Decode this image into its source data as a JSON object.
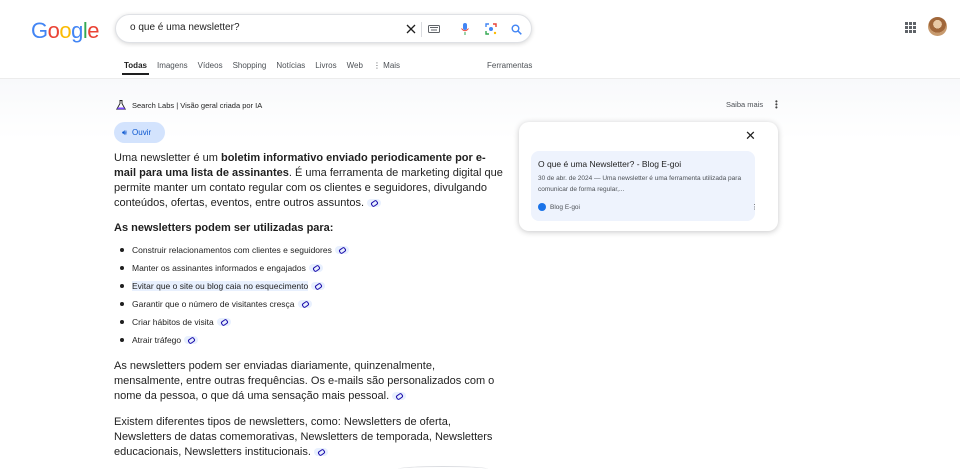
{
  "logo": {
    "letters": [
      "G",
      "o",
      "o",
      "g",
      "l",
      "e"
    ],
    "colors": [
      "#4285F4",
      "#EA4335",
      "#FBBC05",
      "#4285F4",
      "#34A853",
      "#EA4335"
    ]
  },
  "search": {
    "query": "o que é uma newsletter?",
    "icons": [
      "close-icon",
      "keyboard-icon",
      "mic-icon",
      "lens-icon",
      "search-icon"
    ]
  },
  "tabs": [
    "Todas",
    "Imagens",
    "Vídeos",
    "Shopping",
    "Notícias",
    "Livros",
    "Web",
    "⋮ Mais"
  ],
  "tools": "Ferramentas",
  "overview": {
    "labs_label": "Search Labs | Visão geral criada por IA",
    "saiba_mais": "Saiba mais",
    "ouvir": "Ouvir",
    "intro_plain1": "Uma newsletter é um ",
    "intro_bold": "boletim informativo enviado periodicamente por e-mail para uma lista de assinantes",
    "intro_plain2": ". É uma ferramenta de marketing digital que permite manter um contato regular com os clientes e seguidores, divulgando conteúdos, ofertas, eventos, entre outros assuntos.",
    "heading": "As newsletters podem ser utilizadas para:",
    "bullets": [
      "Construir relacionamentos com clientes e seguidores",
      "Manter os assinantes informados e engajados",
      "Evitar que o site ou blog caia no esquecimento",
      "Garantir que o número de visitantes cresça",
      "Criar hábitos de visita",
      "Atrair tráfego"
    ],
    "para2": "As newsletters podem ser enviadas diariamente, quinzenalmente, mensalmente, entre outras frequências. Os e-mails são personalizados com o nome da pessoa, o que dá uma sensação mais pessoal.",
    "para3": "Existem diferentes tipos de newsletters, como: Newsletters de oferta, Newsletters de datas comemorativas, Newsletters de temporada, Newsletters educacionais, Newsletters institucionais."
  },
  "source_card": {
    "title": "O que é uma Newsletter? - Blog E-goi",
    "snippet": "30 de abr. de 2024 — Uma newsletter é uma ferramenta utilizada para comunicar de forma regular,...",
    "site": "Blog E-goi"
  }
}
